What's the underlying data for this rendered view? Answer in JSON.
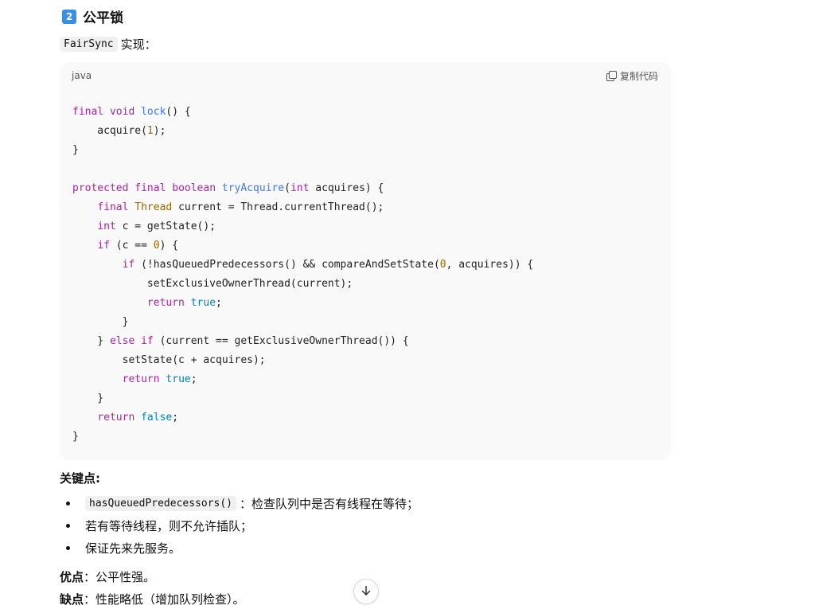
{
  "section": {
    "badge": "2",
    "title": "公平锁"
  },
  "impl": {
    "class_name": "FairSync",
    "suffix": "实现："
  },
  "code_block": {
    "language": "java",
    "copy_label": "复制代码",
    "lines": [
      "final void lock() {",
      "    acquire(1);",
      "}",
      "",
      "protected final boolean tryAcquire(int acquires) {",
      "    final Thread current = Thread.currentThread();",
      "    int c = getState();",
      "    if (c == 0) {",
      "        if (!hasQueuedPredecessors() && compareAndSetState(0, acquires)) {",
      "            setExclusiveOwnerThread(current);",
      "            return true;",
      "        }",
      "    } else if (current == getExclusiveOwnerThread()) {",
      "        setState(c + acquires);",
      "        return true;",
      "    }",
      "    return false;",
      "}"
    ]
  },
  "key_points": {
    "title": "关键点:",
    "items": [
      {
        "code": "hasQueuedPredecessors()",
        "text": "：检查队列中是否有线程在等待；"
      },
      {
        "code": "",
        "text": "若有等待线程，则不允许插队；"
      },
      {
        "code": "",
        "text": "保证先来先服务。"
      }
    ]
  },
  "pros": {
    "label": "优点",
    "text": "：公平性强。"
  },
  "cons": {
    "label": "缺点",
    "text": "：性能略低（增加队列检查）。"
  },
  "icons": {
    "copy": "copy-icon",
    "scroll": "arrow-down-icon"
  }
}
